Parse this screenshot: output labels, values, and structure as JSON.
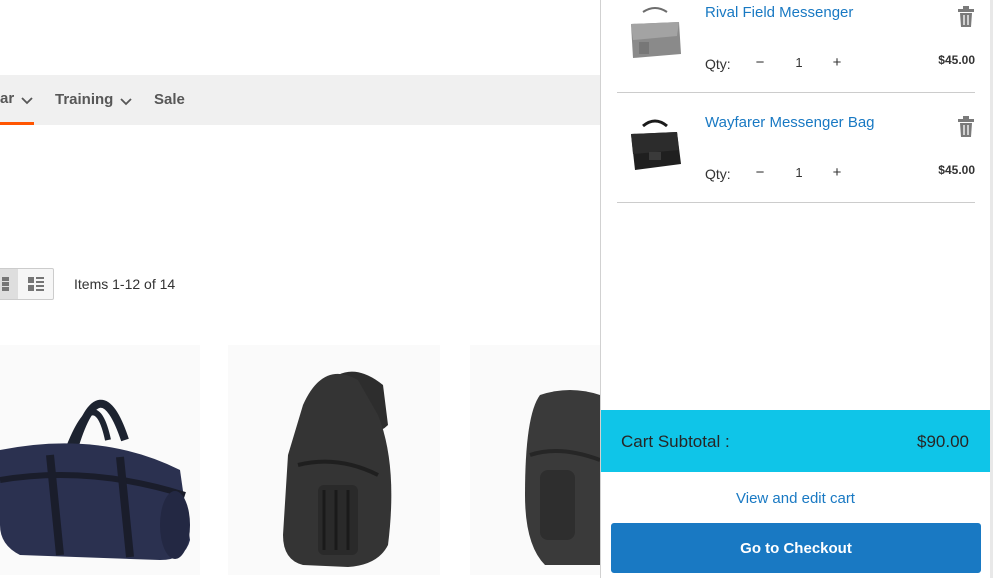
{
  "nav": {
    "items": [
      {
        "label": "ar",
        "icon": "chevron-down-icon"
      },
      {
        "label": "Training",
        "icon": "chevron-down-icon"
      },
      {
        "label": "Sale"
      }
    ],
    "active_color": "#ff5501"
  },
  "toolbar": {
    "items_count": "Items 1-12 of 14",
    "modes": [
      "grid-view-icon",
      "list-view-icon"
    ]
  },
  "minicart": {
    "items": [
      {
        "name": "Rival Field Messenger",
        "qty_label": "Qty:",
        "qty": "1",
        "price": "$45.00",
        "minus": "−",
        "plus": "+"
      },
      {
        "name": "Wayfarer Messenger Bag",
        "qty_label": "Qty:",
        "qty": "1",
        "price": "$45.00",
        "minus": "−",
        "plus": "+"
      }
    ],
    "subtotal_label": "Cart Subtotal :",
    "subtotal_value": "$90.00",
    "view_cart": "View and edit cart",
    "checkout": "Go to Checkout",
    "colors": {
      "subtotal_bg": "#0fc5e8",
      "link": "#1979c3",
      "button": "#1979c3"
    }
  }
}
